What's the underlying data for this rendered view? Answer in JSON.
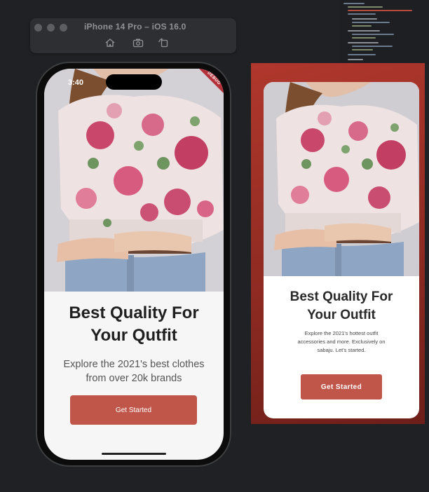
{
  "simulator": {
    "title": "iPhone 14 Pro – iOS 16.0",
    "toolbar_icons": [
      "home-icon",
      "screenshot-icon",
      "rotate-icon"
    ]
  },
  "device": {
    "status_time": "3:40",
    "debug_banner": "DEBUG"
  },
  "app_screen": {
    "title_line1": "Best Quality For",
    "title_line2": "Your Qutfit",
    "subtitle_line1": "Explore the 2021's best clothes",
    "subtitle_line2": "from over 20k brands",
    "button_label": "Get Started"
  },
  "design_preview": {
    "title_line1": "Best Quality For",
    "title_line2": "Your Outfit",
    "subtitle_line1": "Explore the 2021's hottest outfit",
    "subtitle_line2": "accessories and more. Exclusively on",
    "subtitle_line3": "sabaju. Let's started.",
    "button_label": "Get Started"
  },
  "colors": {
    "background": "#1f2124",
    "accent_button": "#c0564a",
    "preview_frame": "#a3332a",
    "debug_banner": "#b5313a"
  }
}
